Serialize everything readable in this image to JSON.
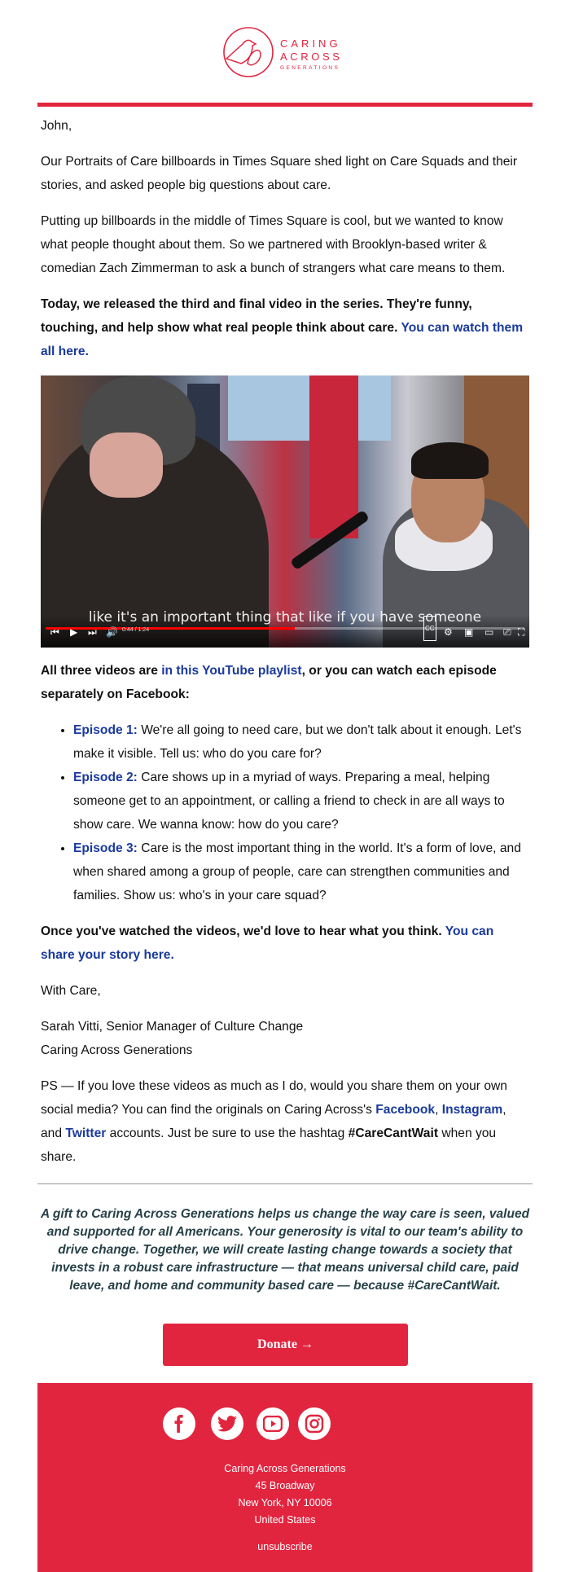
{
  "brand": {
    "logo_text": [
      "CARING",
      "ACROSS",
      "GENERATIONS"
    ],
    "accent": "#e2253f",
    "link": "#1a3a9e"
  },
  "greeting": "John,",
  "p1": "Our Portraits of Care billboards in Times Square shed light on Care Squads and their stories, and asked people big questions about care.",
  "p2": "Putting up billboards in the middle of Times Square is cool, but we wanted to know what people thought about them. So we partnered with Brooklyn-based writer & comedian Zach Zimmerman to ask a bunch of strangers what care means to them.",
  "p3": {
    "bold": "Today, we released the third and final video in the series. They're funny, touching, and help show what real people think about care. ",
    "link": "You can watch them all here."
  },
  "video": {
    "caption": "like it's an important thing that like if you have someone",
    "time": "0:44 / 1:24",
    "progress": 0.52
  },
  "p4": {
    "pre": "All three videos are ",
    "link": "in this YouTube playlist",
    "post": ", or you can watch each episode separately on Facebook:"
  },
  "episodes": [
    {
      "label": "Episode 1:",
      "text": " We're all going to need care, but we don't talk about it enough. Let's make it visible. Tell us: who do you care for?"
    },
    {
      "label": "Episode 2:",
      "text": " Care shows up in a myriad of ways. Preparing a meal, helping someone get to an appointment, or calling a friend to check in are all ways to show care. We wanna know: how do you care?"
    },
    {
      "label": "Episode 3:",
      "text": " Care is the most important thing in the world. It's a form of love, and when shared among a group of people, care can strengthen communities and families. Show us: who's in your care squad?"
    }
  ],
  "p5": {
    "bold": "Once you've watched the videos, we'd love to hear what you think. ",
    "link": "You can share your story here."
  },
  "signoff": "With Care,",
  "sig_name": "Sarah Vitti, Senior Manager of Culture Change",
  "sig_org": "Caring Across Generations",
  "ps": {
    "t1": "PS — If you love these videos as much as I do, would you share them on your own social media? You can find the originals on Caring Across's ",
    "fb": "Facebook",
    "t2": ", ",
    "ig": "Instagram",
    "t3": ", and ",
    "tw": "Twitter",
    "t4": " accounts. Just be sure to use the hashtag ",
    "tag": "#CareCantWait",
    "t5": " when you share."
  },
  "appeal": "A gift to Caring Across Generations helps us change the way care is seen, valued and supported for all Americans. Your generosity is vital to our team's ability to drive change. Together, we will create lasting change towards a society that invests in a robust care infrastructure — that means universal child care, paid leave, and home and community based care — because #CareCantWait.",
  "donate": "Donate →",
  "footer": {
    "social": [
      "facebook",
      "twitter",
      "youtube",
      "instagram"
    ],
    "org": "Caring Across Generations",
    "street": "45 Broadway",
    "city": "New York, NY 10006",
    "country": "United States",
    "unsubscribe": "unsubscribe"
  }
}
